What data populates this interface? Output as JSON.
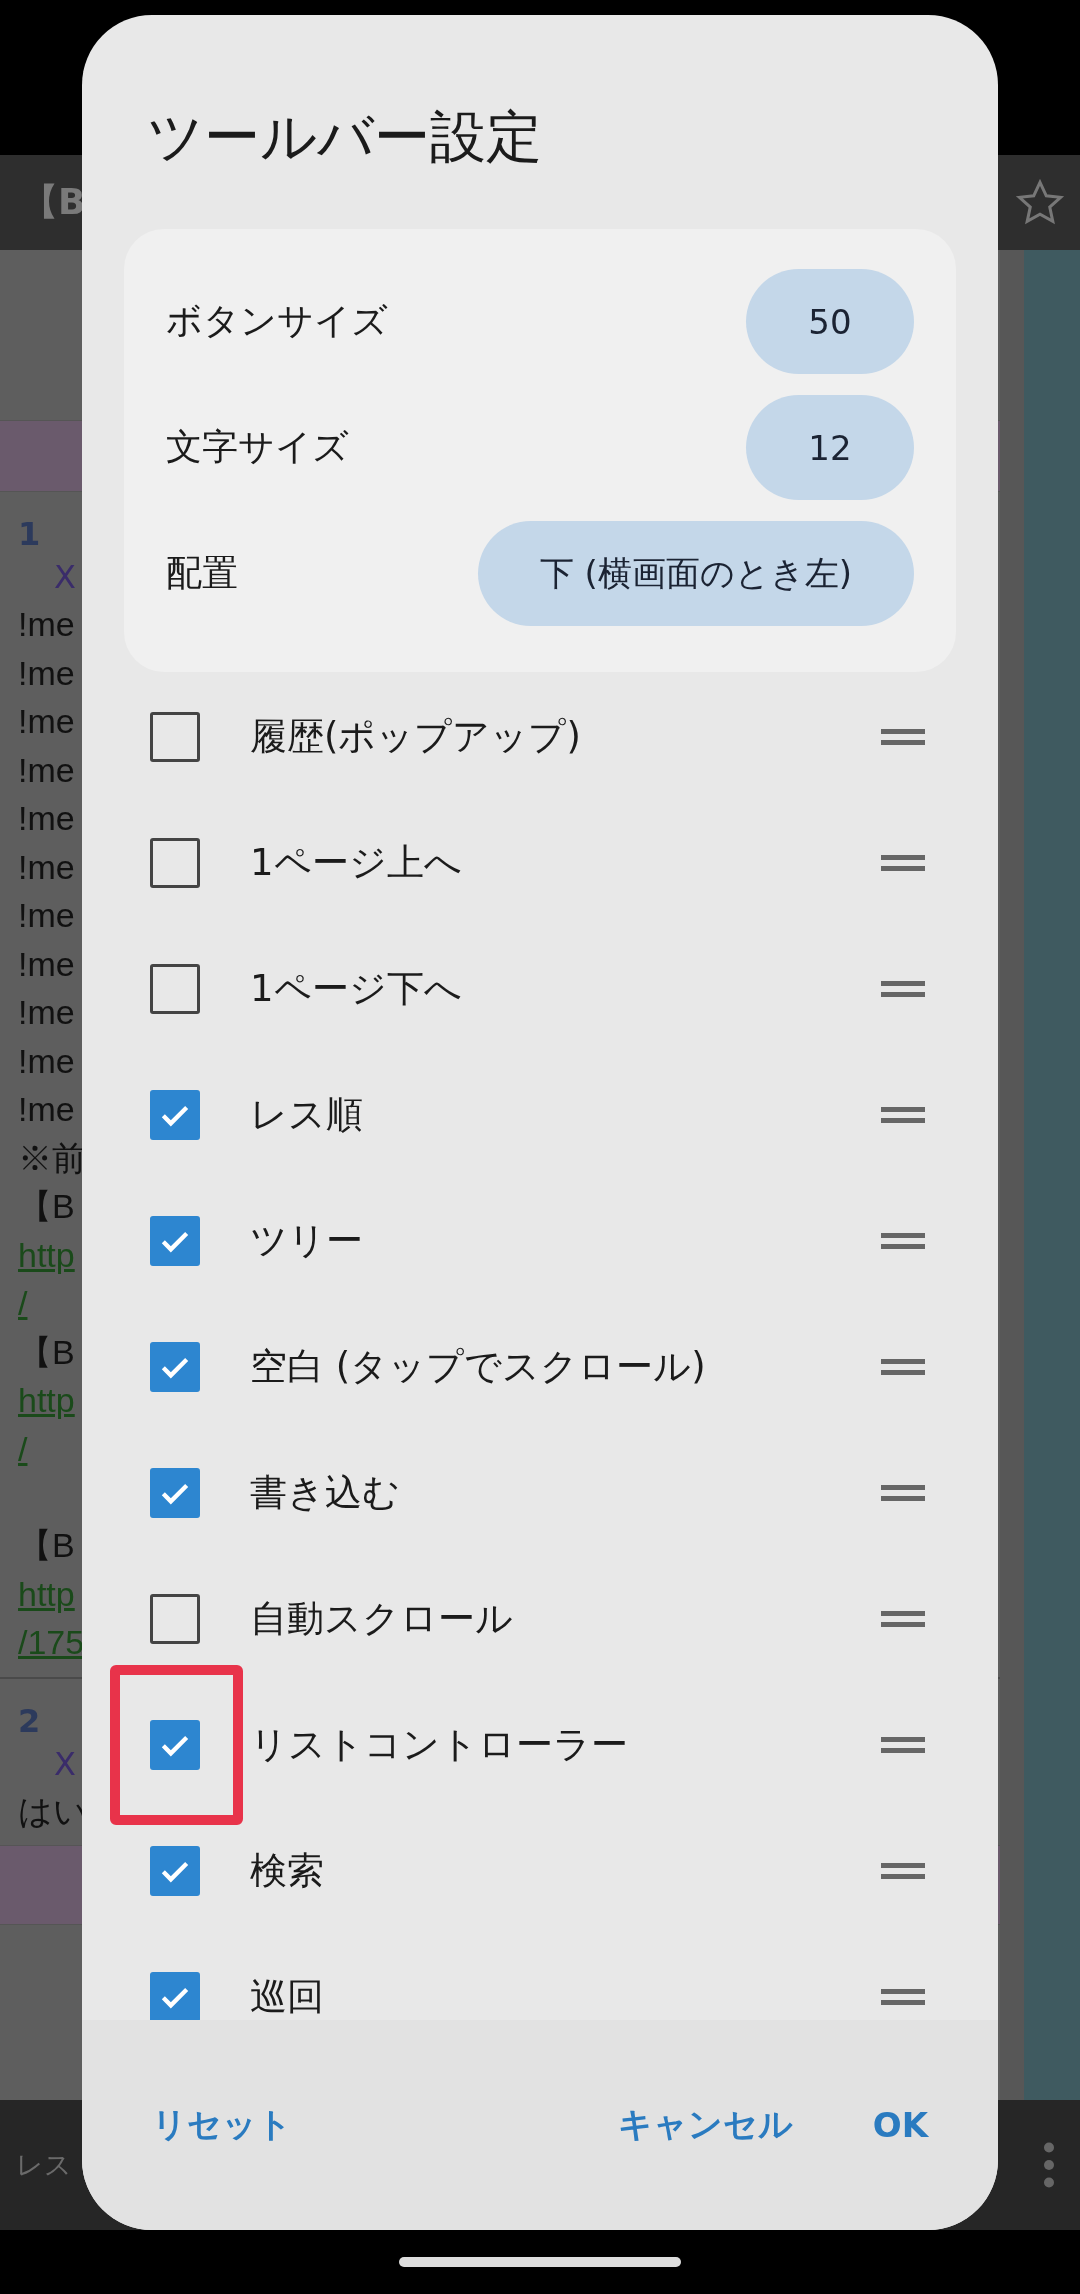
{
  "background": {
    "top_bar": {
      "title": "【B"
    },
    "posts": [
      {
        "number": "1",
        "id": "X",
        "lines": [
          {
            "kind": "text",
            "text": "!me"
          },
          {
            "kind": "text",
            "text": "!me"
          },
          {
            "kind": "text",
            "text": "!me"
          },
          {
            "kind": "text",
            "text": "!me"
          },
          {
            "kind": "text",
            "text": "!me"
          },
          {
            "kind": "text",
            "text": "!me"
          },
          {
            "kind": "text",
            "text": "!me"
          },
          {
            "kind": "text",
            "text": "!me"
          },
          {
            "kind": "text",
            "text": "!me"
          },
          {
            "kind": "text",
            "text": "!me"
          },
          {
            "kind": "text",
            "text": "!me"
          },
          {
            "kind": "text",
            "text": "※前"
          },
          {
            "kind": "text",
            "text": "【B"
          },
          {
            "kind": "link",
            "text": "http"
          },
          {
            "kind": "link",
            "text": "/"
          },
          {
            "kind": "text",
            "text": "【B"
          },
          {
            "kind": "link",
            "text": "http"
          },
          {
            "kind": "link",
            "text": "/"
          },
          {
            "kind": "text",
            "text": "【B",
            "gap_before": true
          },
          {
            "kind": "link",
            "text": "http"
          },
          {
            "kind": "link",
            "text": "/175"
          }
        ]
      },
      {
        "number": "2",
        "id": "X",
        "lines": [
          {
            "kind": "text",
            "text": "はい"
          }
        ]
      }
    ],
    "bottom_bar": {
      "label": "レス"
    }
  },
  "dialog": {
    "title": "ツールバー設定",
    "settings": [
      {
        "label": "ボタンサイズ",
        "value": "50"
      },
      {
        "label": "文字サイズ",
        "value": "12"
      },
      {
        "label": "配置",
        "value": "下 (横画面のとき左)"
      }
    ],
    "items": [
      {
        "label": "履歴(ポップアップ)",
        "checked": false,
        "highlighted": false
      },
      {
        "label": "1ページ上へ",
        "checked": false,
        "highlighted": false
      },
      {
        "label": "1ページ下へ",
        "checked": false,
        "highlighted": false
      },
      {
        "label": "レス順",
        "checked": true,
        "highlighted": false
      },
      {
        "label": "ツリー",
        "checked": true,
        "highlighted": false
      },
      {
        "label": "空白 (タップでスクロール)",
        "checked": true,
        "highlighted": false
      },
      {
        "label": "書き込む",
        "checked": true,
        "highlighted": false
      },
      {
        "label": "自動スクロール",
        "checked": false,
        "highlighted": false
      },
      {
        "label": "リストコントローラー",
        "checked": true,
        "highlighted": true
      },
      {
        "label": "検索",
        "checked": true,
        "highlighted": false
      },
      {
        "label": "巡回",
        "checked": true,
        "highlighted": false
      }
    ],
    "buttons": {
      "reset": "リセット",
      "cancel": "キャンセル",
      "ok": "OK"
    }
  }
}
